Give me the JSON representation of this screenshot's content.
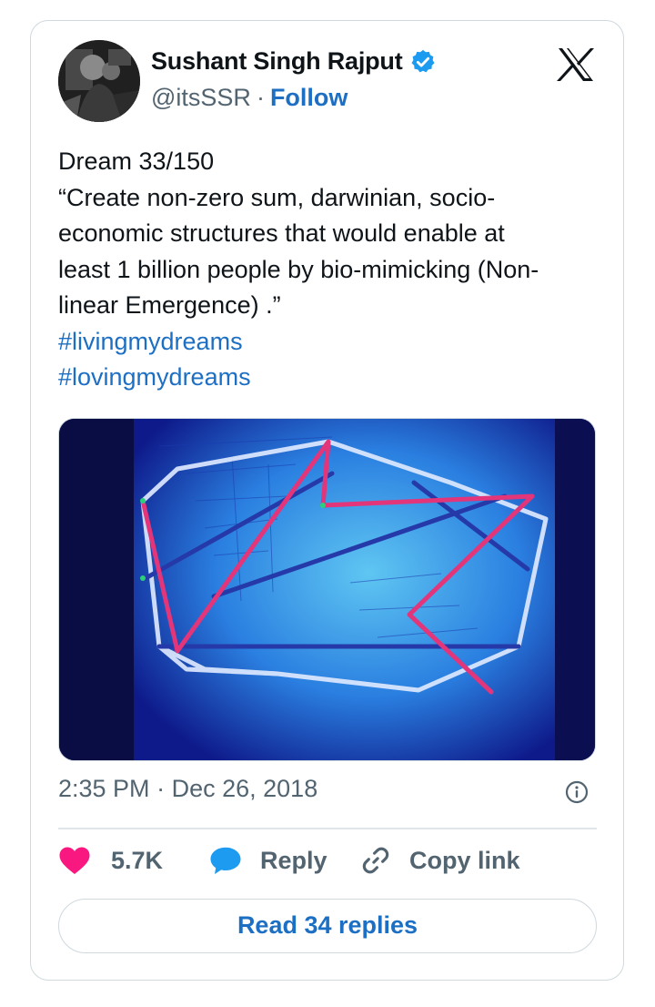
{
  "author": {
    "name": "Sushant Singh Rajput",
    "handle": "@itsSSR",
    "separator": "·",
    "follow_label": "Follow",
    "verified": true,
    "verified_color": "#1d9bf0"
  },
  "tweet": {
    "lines": [
      "Dream 33/150",
      "“Create non-zero sum, darwinian, socio-",
      "economic structures that would enable at",
      "least 1 billion people by bio-mimicking (Non-",
      "linear Emergence) .”"
    ],
    "hashtags": [
      "#livingmydreams",
      "#lovingmydreams"
    ]
  },
  "timestamp": {
    "time": "2:35 PM",
    "separator": "·",
    "date": "Dec 26, 2018"
  },
  "actions": {
    "likes": "5.7K",
    "reply_label": "Reply",
    "copy_label": "Copy link"
  },
  "read_replies_label": "Read 34 replies",
  "colors": {
    "link": "#1d6fc4",
    "like": "#f91880",
    "reply_icon": "#1d9bf0",
    "muted": "#536471",
    "border": "#cfd9de"
  },
  "icons": {
    "verified": "verified-badge-icon",
    "logo": "x-logo-icon",
    "like": "heart-icon",
    "reply": "speech-bubble-icon",
    "copy": "link-icon",
    "info": "info-icon"
  }
}
